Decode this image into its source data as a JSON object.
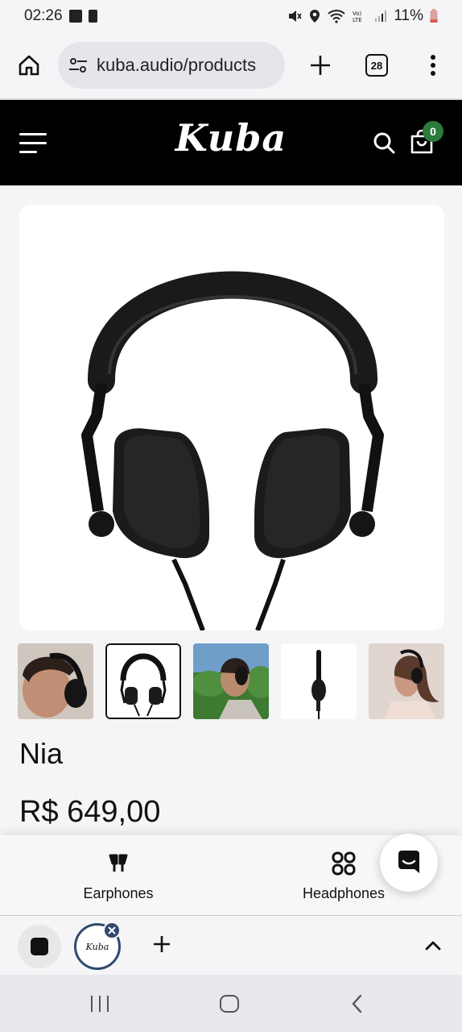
{
  "status_bar": {
    "time": "02:26",
    "battery": "11%"
  },
  "browser": {
    "url": "kuba.audio/products",
    "tab_count": "28"
  },
  "site": {
    "logo": "Kuba",
    "cart_count": "0"
  },
  "product": {
    "name": "Nia",
    "price": "R$ 649,00"
  },
  "thumbnails": [
    "photo-man-side",
    "headphones-front",
    "photo-man-outdoor",
    "headphones-side",
    "photo-woman-side"
  ],
  "category_nav": {
    "earphones_label": "Earphones",
    "headphones_label": "Headphones"
  },
  "colors": {
    "header_bg": "#000000",
    "badge_green": "#2c7a3c",
    "tab_ring": "#2f4a6b"
  }
}
